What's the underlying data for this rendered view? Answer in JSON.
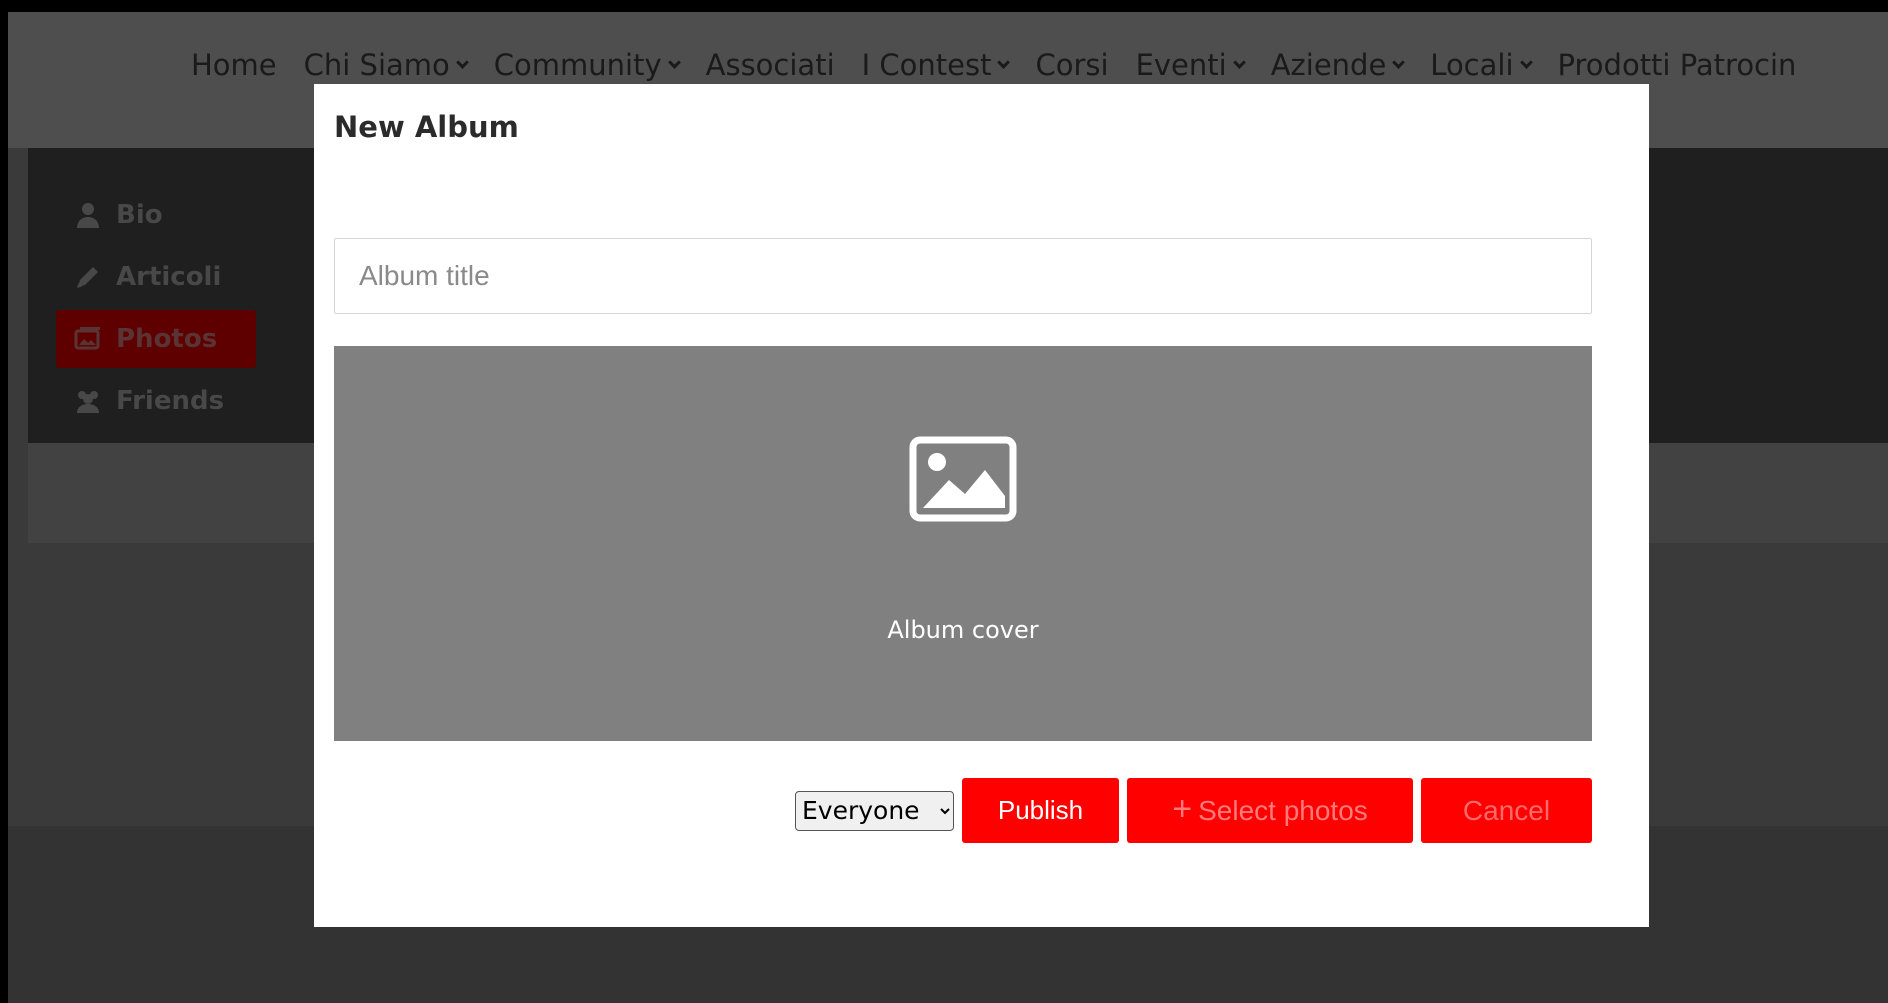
{
  "nav": {
    "items": [
      {
        "label": "Home",
        "dropdown": false
      },
      {
        "label": "Chi Siamo",
        "dropdown": true
      },
      {
        "label": "Community",
        "dropdown": true
      },
      {
        "label": "Associati",
        "dropdown": false
      },
      {
        "label": "I Contest",
        "dropdown": true
      },
      {
        "label": "Corsi",
        "dropdown": false
      },
      {
        "label": "Eventi",
        "dropdown": true
      },
      {
        "label": "Aziende",
        "dropdown": true
      },
      {
        "label": "Locali",
        "dropdown": true
      },
      {
        "label": "Prodotti Patrocin",
        "dropdown": false
      }
    ]
  },
  "sidebar": {
    "items": [
      {
        "label": "Bio",
        "icon": "user-icon",
        "active": false
      },
      {
        "label": "Articoli",
        "icon": "pencil-icon",
        "active": false
      },
      {
        "label": "Photos",
        "icon": "photos-icon",
        "active": true
      },
      {
        "label": "Friends",
        "icon": "users-icon",
        "active": false
      }
    ]
  },
  "modal": {
    "title": "New Album",
    "album_title_placeholder": "Album title",
    "album_title_value": "",
    "cover_label": "Album cover",
    "cover_icon": "image-icon",
    "privacy": {
      "selected": "Everyone"
    },
    "publish_label": "Publish",
    "select_photos_label": "Select photos",
    "cancel_label": "Cancel"
  },
  "colors": {
    "accent": "#ff0000",
    "overlay": "#3a3a3a",
    "cover_bg": "#808080"
  }
}
